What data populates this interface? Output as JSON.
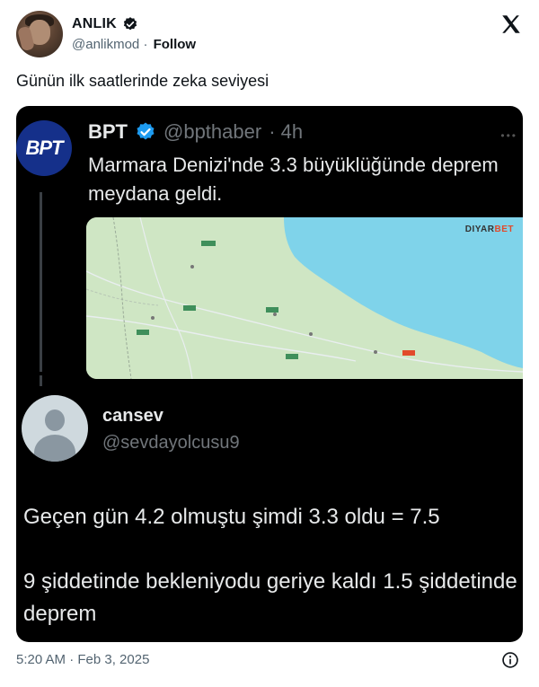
{
  "author": {
    "name": "ANLIK",
    "handle": "@anlikmod",
    "separator": "·",
    "follow_label": "Follow"
  },
  "icons": {
    "verified": "verified-badge-icon",
    "brand": "x-logo-icon",
    "info": "info-icon"
  },
  "colors": {
    "verified_blue": "#1d9bf0",
    "media_bg": "#000000",
    "sea": "#7fd3ea",
    "land": "#cfe6c4",
    "quoted_avatar_bg": "#15308a"
  },
  "tweet": {
    "text": "Günün ilk saatlerinde zeka seviyesi"
  },
  "quoted": {
    "avatar_label": "BPT",
    "name": "BPT",
    "handle": "@bpthaber",
    "time": "· 4h",
    "text": "Marmara Denizi'nde 3.3 büyüklüğünde deprem meydana geldi.",
    "map": {
      "brand_main": "DIYAR",
      "brand_accent": "BET"
    }
  },
  "reply": {
    "name": "cansev",
    "handle": "@sevdayolcusu9",
    "line1": "Geçen gün 4.2 olmuştu şimdi 3.3 oldu = 7.5",
    "line2": "9 şiddetinde bekleniyodu geriye kaldı 1.5 şiddetinde deprem"
  },
  "footer": {
    "timestamp": "5:20 AM · Feb 3, 2025"
  }
}
